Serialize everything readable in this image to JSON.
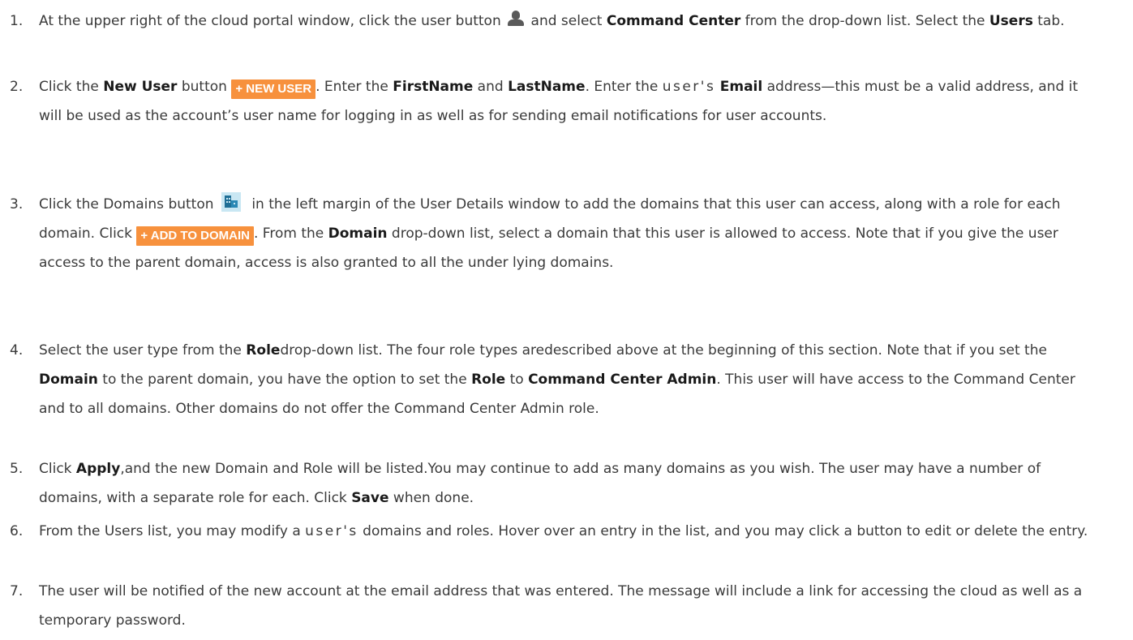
{
  "steps": [
    {
      "number": "1.",
      "parts": [
        "At the upper right of the cloud portal window, click the user button ",
        " and select ",
        "Command Center",
        " from the drop-down list. Select the ",
        "Users",
        " tab."
      ]
    },
    {
      "number": "2.",
      "parts": [
        "Click the ",
        "New User",
        " button ",
        "+ NEW USER",
        ". Enter the ",
        "FirstName",
        " and ",
        "LastName",
        ". Enter the ",
        "user's",
        " ",
        "Email",
        " address—this must be a valid address, and it will be used as the account’s user name for logging in as well as for sending email notifications for user accounts."
      ]
    },
    {
      "number": "3.",
      "parts": [
        "Click the Domains button ",
        " in the left margin of the User Details window to add the domains that this user can access, along with a role for each domain. Click ",
        "+ ADD TO DOMAIN",
        ". From the ",
        "Domain",
        " drop-down list, select a domain that this user is allowed to access. Note that if you give the user access to the parent domain, access is also granted to all the under lying domains."
      ]
    },
    {
      "number": "4.",
      "parts": [
        "Select the user type from the ",
        "Role",
        "drop-down list. The four role types aredescribed above at the beginning of this section. Note that if you set the ",
        "Domain",
        " to the parent domain, you have the option to set the ",
        "Role",
        " to ",
        "Command Center Admin",
        ". This user will have access to the Command Center and to all domains. Other domains do not offer the Command Center Admin role."
      ]
    },
    {
      "number": "5.",
      "parts": [
        "Click ",
        "Apply",
        ",and the new Domain and Role will be listed.You may continue to add as many domains as you wish. The user may have a number of domains, with a separate role for each. Click ",
        "Save",
        " when done."
      ]
    },
    {
      "number": "6.",
      "parts": [
        "From the Users list, you may modify a ",
        "user's",
        " domains and roles. Hover over an entry in the list, and you may click a button to edit or delete the entry."
      ]
    },
    {
      "number": "7.",
      "parts": [
        "The user will be notified of the new account at the email address that was entered. The message will include a link for accessing the cloud as well as a temporary password."
      ]
    }
  ],
  "colors": {
    "button_orange": "#f7913d",
    "text": "#3a3a3a",
    "domain_icon_bg": "#c9e7f3"
  },
  "icons": {
    "user_button": "user-icon",
    "domains_button": "domains-icon"
  }
}
